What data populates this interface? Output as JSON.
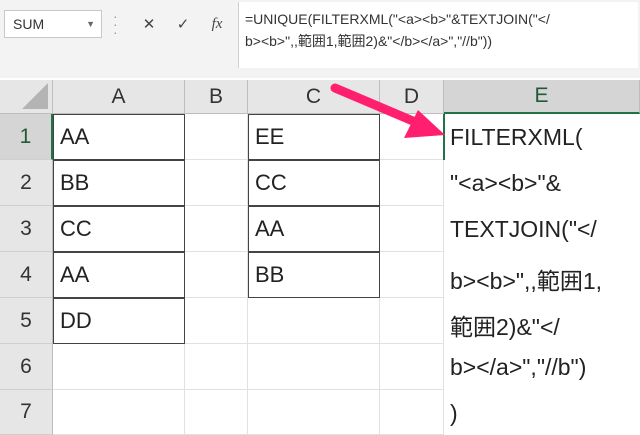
{
  "formula_bar": {
    "name_box": "SUM",
    "cancel_label": "✕",
    "enter_label": "✓",
    "fx_label": "fx",
    "formula_line1": "=UNIQUE(FILTERXML(\"<a><b>\"&TEXTJOIN(\"</",
    "formula_line2": "b><b>\",,範囲1,範囲2)&\"</b></a>\",\"//b\"))"
  },
  "columns": [
    "A",
    "B",
    "C",
    "D",
    "E"
  ],
  "rows": [
    "1",
    "2",
    "3",
    "4",
    "5",
    "6",
    "7"
  ],
  "column_a": [
    "AA",
    "BB",
    "CC",
    "AA",
    "DD"
  ],
  "column_c": [
    "EE",
    "CC",
    "AA",
    "BB"
  ],
  "edit_cell_lines": [
    "FILTERXML(",
    "\"<a><b>\"&",
    "TEXTJOIN(\"</",
    "b><b>\",,範囲1,",
    "範囲2)&\"</",
    "b></a>\",\"//b\")",
    ")"
  ],
  "colors": {
    "accent": "#217346",
    "arrow": "#ff1f6e",
    "paren": "#b06ac7"
  }
}
